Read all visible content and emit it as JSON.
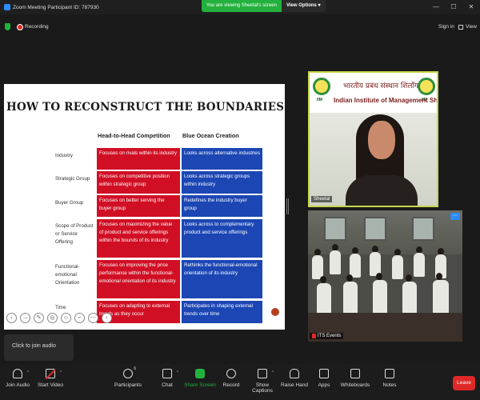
{
  "window": {
    "title": "Zoom Meeting Participant ID: 787930",
    "minimize": "—",
    "maximize": "☐",
    "close": "✕"
  },
  "banner": {
    "message": "You are viewing Sheetal's screen",
    "view_options": "View Options",
    "caret": "▾"
  },
  "topbar": {
    "recording": "Recording",
    "sign_in": "Sign in",
    "view": "View"
  },
  "slide": {
    "title": "HOW TO RECONSTRUCT THE BOUNDARIES OF THE INDUSTRY?",
    "col_head_to_head": "Head-to-Head Competition",
    "col_blue_ocean": "Blue Ocean Creation",
    "rows": [
      {
        "label": "Industry",
        "red": "Focuses on rivals within its industry",
        "blue": "Looks across alternative industries"
      },
      {
        "label": "Strategic Group",
        "red": "Focuses on competitive position within strategic group",
        "blue": "Looks across strategic groups within industry"
      },
      {
        "label": "Buyer Group",
        "red": "Focuses on better serving the buyer group",
        "blue": "Redefines the industry buyer group"
      },
      {
        "label": "Scope of Product or Service Offering",
        "red": "Focuses on maximizing the value of product and service offerings within the bounds of its industry",
        "blue": "Looks across to complementary product and service offerings"
      },
      {
        "label": "Functional-emotional Orientation",
        "red": "Focuses on improving the price performance within the functional-emotional orientation of its industry",
        "blue": "Rethinks the functional-emotional orientation of its industry"
      },
      {
        "label": "Time",
        "red": "Focuses on adapting to external trends as they occur",
        "blue": "Participates in shaping external trends over time"
      }
    ],
    "controls": [
      "‹",
      "→",
      "✎",
      "◎",
      "☺",
      "⌐",
      "⋯",
      "›"
    ]
  },
  "speaker_tile": {
    "hindi": "भारतीय प्रबंध संस्थान शिलॉंग",
    "institute": "Indian Institute of Management Shillong",
    "logo_text": "IIM",
    "name": "Sheetal"
  },
  "audience_tile": {
    "name": "ITS Events",
    "menu": "⋯"
  },
  "tooltip": "Click to join audio",
  "toolbar": {
    "join_audio": "Join Audio",
    "start_video": "Start Video",
    "participants": "Participants",
    "participants_count": "6",
    "chat": "Chat",
    "share_screen": "Share Screen",
    "record": "Record",
    "show_captions": "Show Captions",
    "raise_hand": "Raise Hand",
    "apps": "Apps",
    "whiteboards": "Whiteboards",
    "notes": "Notes",
    "leave": "Leave",
    "caret": "^"
  },
  "colors": {
    "accent_green": "#23b13d",
    "zoom_blue": "#2d8cff",
    "leave_red": "#e02828",
    "cell_red": "#d10f24",
    "cell_blue": "#1b46b4"
  }
}
